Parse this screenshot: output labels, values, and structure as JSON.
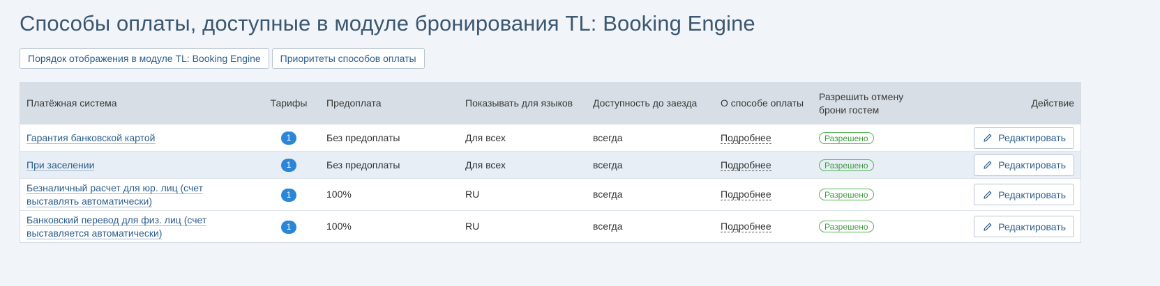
{
  "page": {
    "title": "Способы оплаты, доступные в модуле бронирования TL: Booking Engine"
  },
  "tabs": [
    {
      "label": "Порядок отображения в модуле TL: Booking Engine"
    },
    {
      "label": "Приоритеты способов оплаты"
    }
  ],
  "table": {
    "headers": {
      "system": "Платёжная система",
      "tariffs": "Тарифы",
      "prepayment": "Предоплата",
      "languages": "Показывать для языков",
      "availability": "Доступность до заезда",
      "about": "О способе оплаты",
      "cancel_line1": "Разрешить отмену",
      "cancel_line2": "брони гостем",
      "action": "Действие"
    },
    "rows": [
      {
        "name": "Гарантия банковской картой",
        "tariffs": "1",
        "prepayment": "Без предоплаты",
        "languages": "Для всех",
        "availability": "всегда",
        "about": "Подробнее",
        "cancel": "Разрешено",
        "action": "Редактировать"
      },
      {
        "name": "При заселении",
        "tariffs": "1",
        "prepayment": "Без предоплаты",
        "languages": "Для всех",
        "availability": "всегда",
        "about": "Подробнее",
        "cancel": "Разрешено",
        "action": "Редактировать"
      },
      {
        "name_line1": "Безналичный расчет для юр. лиц (счет",
        "name_line2": "выставлять автоматически)",
        "tariffs": "1",
        "prepayment": "100%",
        "languages": "RU",
        "availability": "всегда",
        "about": "Подробнее",
        "cancel": "Разрешено",
        "action": "Редактировать"
      },
      {
        "name_line1": "Банковский перевод для физ. лиц (счет",
        "name_line2": "выставляется автоматически)",
        "tariffs": "1",
        "prepayment": "100%",
        "languages": "RU",
        "availability": "всегда",
        "about": "Подробнее",
        "cancel": "Разрешено",
        "action": "Редактировать"
      }
    ]
  },
  "icons": {
    "edit": "pencil-icon"
  },
  "colors": {
    "accent": "#2c86d8",
    "link": "#2d5f8d",
    "status_ok": "#3f9c3f",
    "header_bg": "#d7dee5",
    "row_highlight": "#e7eef6"
  }
}
